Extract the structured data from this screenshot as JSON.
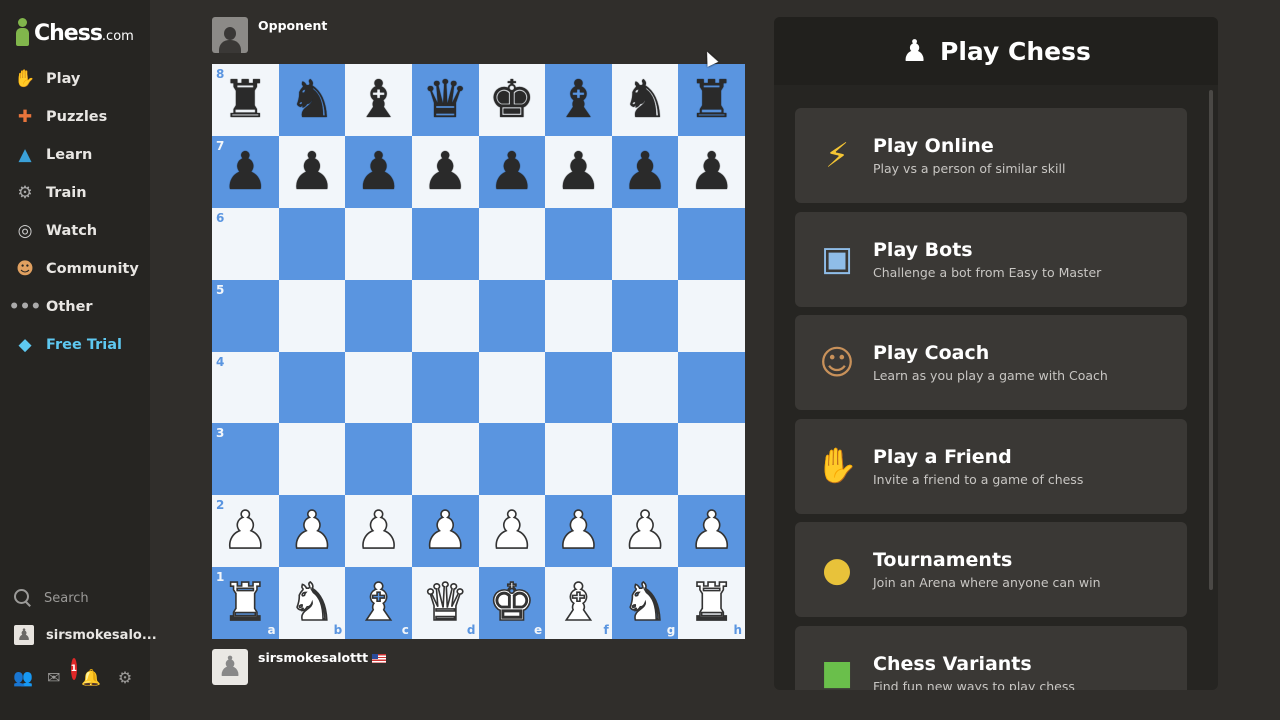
{
  "app": {
    "brand": "Chess",
    "brand_tld": ".com",
    "accent": "#81b64c"
  },
  "sidebar": {
    "items": [
      {
        "label": "Play",
        "icon": "play-hand-icon"
      },
      {
        "label": "Puzzles",
        "icon": "puzzle-icon"
      },
      {
        "label": "Learn",
        "icon": "graduation-cap-icon"
      },
      {
        "label": "Train",
        "icon": "train-icon"
      },
      {
        "label": "Watch",
        "icon": "binoculars-icon"
      },
      {
        "label": "Community",
        "icon": "community-icon"
      },
      {
        "label": "Other",
        "icon": "more-dots-icon"
      },
      {
        "label": "Free Trial",
        "icon": "diamond-icon"
      }
    ],
    "search_label": "Search",
    "username": "sirsmokesalo...",
    "notification_count": "1"
  },
  "game": {
    "opponent_name": "Opponent",
    "player_name": "sirsmokesalottt",
    "board": [
      [
        "r",
        "n",
        "b",
        "q",
        "k",
        "b",
        "n",
        "r"
      ],
      [
        "p",
        "p",
        "p",
        "p",
        "p",
        "p",
        "p",
        "p"
      ],
      [
        "",
        "",
        "",
        "",
        "",
        "",
        "",
        ""
      ],
      [
        "",
        "",
        "",
        "",
        "",
        "",
        "",
        ""
      ],
      [
        "",
        "",
        "",
        "",
        "",
        "",
        "",
        ""
      ],
      [
        "",
        "",
        "",
        "",
        "",
        "",
        "",
        ""
      ],
      [
        "P",
        "P",
        "P",
        "P",
        "P",
        "P",
        "P",
        "P"
      ],
      [
        "R",
        "N",
        "B",
        "Q",
        "K",
        "B",
        "N",
        "R"
      ]
    ],
    "ranks": [
      "8",
      "7",
      "6",
      "5",
      "4",
      "3",
      "2",
      "1"
    ],
    "files": [
      "a",
      "b",
      "c",
      "d",
      "e",
      "f",
      "g",
      "h"
    ],
    "light_color": "#f2f6fa",
    "dark_color": "#5a95e0"
  },
  "panel": {
    "title": "Play Chess",
    "cards": [
      {
        "title": "Play Online",
        "desc": "Play vs a person of similar skill",
        "icon": "lightning-icon"
      },
      {
        "title": "Play Bots",
        "desc": "Challenge a bot from Easy to Master",
        "icon": "robot-icon"
      },
      {
        "title": "Play Coach",
        "desc": "Learn as you play a game with Coach",
        "icon": "coach-icon"
      },
      {
        "title": "Play a Friend",
        "desc": "Invite a friend to a game of chess",
        "icon": "handshake-icon"
      },
      {
        "title": "Tournaments",
        "desc": "Join an Arena where anyone can win",
        "icon": "medal-icon"
      },
      {
        "title": "Chess Variants",
        "desc": "Find fun new ways to play chess",
        "icon": "variants-cube-icon"
      }
    ]
  }
}
